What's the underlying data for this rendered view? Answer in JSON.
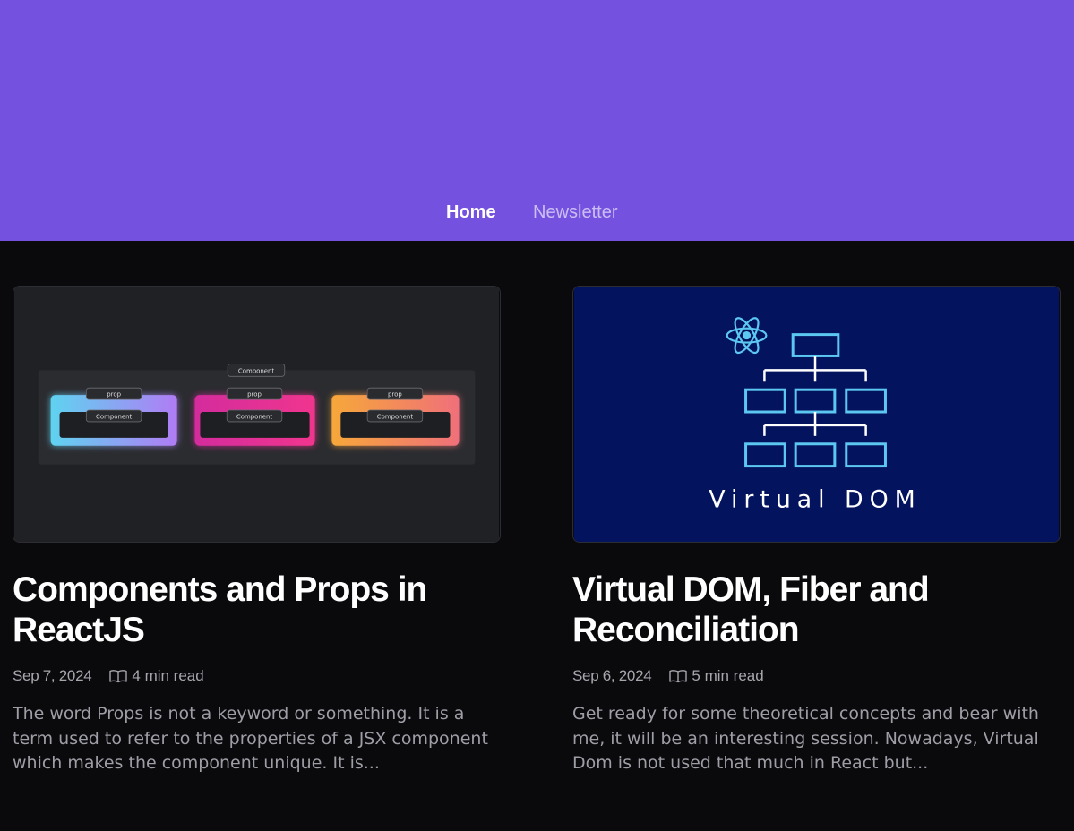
{
  "nav": {
    "home": "Home",
    "newsletter": "Newsletter"
  },
  "colors": {
    "header_bg": "#7452df",
    "page_bg": "#0a0a0c"
  },
  "posts": [
    {
      "thumbnail": {
        "labels": [
          "Component",
          "prop",
          "Component",
          "prop",
          "Component",
          "prop",
          "Component"
        ]
      },
      "title": "Components and Props in ReactJS",
      "date": "Sep 7, 2024",
      "read_time": "4 min read",
      "excerpt": "The word Props is not a keyword or something. It is a term used to refer to the properties of a JSX component which makes the component unique. It is..."
    },
    {
      "thumbnail": {
        "caption": "Virtual DOM",
        "icon": "react-atom-icon"
      },
      "title": "Virtual DOM, Fiber and Reconciliation",
      "date": "Sep 6, 2024",
      "read_time": "5 min read",
      "excerpt": "Get ready for some theoretical concepts and bear with me, it will be an interesting session. Nowadays, Virtual Dom is not used that much in React but..."
    }
  ]
}
